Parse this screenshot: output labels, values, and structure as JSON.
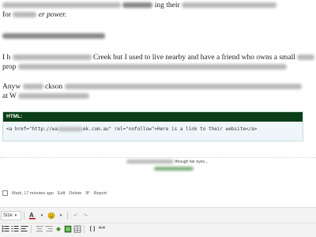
{
  "post": {
    "line1_frag": "ing their",
    "line2_frag": "for",
    "line2_italic": "er power.",
    "line4_frag": "I h",
    "line4_mid": "Creek but I used to live nearby and have a friend who owns a small",
    "line4_end": "acr",
    "line5_frag": "prop",
    "line6_start": "Anyw",
    "line6_mid": "ckson",
    "line7_start": "at W"
  },
  "code_box": {
    "header": "HTML:",
    "code_prefix": "<a href=\"http://wa",
    "code_suffix": "ek.com.au\" rel=\"nofollow\">Here is a link to their website</a>"
  },
  "signature": {
    "text": "through her eyes..."
  },
  "comment_meta": {
    "author_time": "Mark, 17 minutes ago",
    "actions": [
      "Edit",
      "Delete",
      "IP",
      "Report"
    ]
  },
  "editor": {
    "size_label": "Size",
    "row1_icons": [
      "font-color-icon",
      "emoji-icon",
      "undo-icon",
      "redo-icon"
    ],
    "row2_icons": [
      "bulleted-list-icon",
      "numbered-list-icon",
      "align-left-icon",
      "align-center-icon",
      "align-right-icon",
      "link-icon",
      "image-icon",
      "table-icon",
      "code-icon",
      "quote-icon"
    ],
    "code_label": "[]",
    "quote_label": "““"
  }
}
